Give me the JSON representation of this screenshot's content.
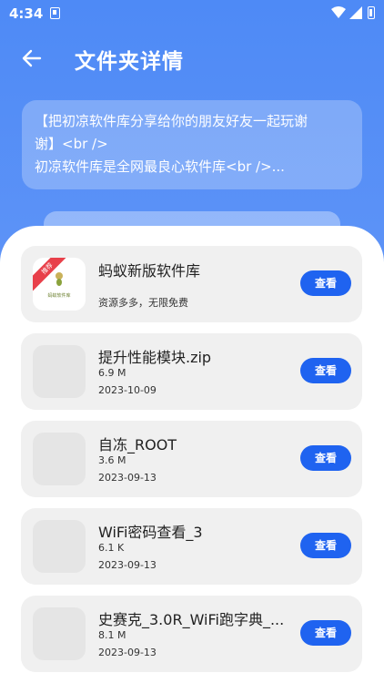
{
  "status_bar": {
    "time": "4:34"
  },
  "header": {
    "title": "文件夹详情"
  },
  "description": {
    "lines": [
      "【把初凉软件库分享给你的朋友好友一起玩谢",
      "谢】<br />",
      "初凉软件库是全网最良心软件库<br />..."
    ]
  },
  "items": [
    {
      "name": "蚂蚁新版软件库",
      "subtitle": "资源多多，无限免费",
      "badge": "推荐",
      "logo_text": "蚂蚁软件库",
      "button": "查看"
    },
    {
      "name": "提升性能模块.zip",
      "size": "6.9 M",
      "date": "2023-10-09",
      "button": "查看"
    },
    {
      "name": "自冻_ROOT",
      "size": "3.6 M",
      "date": "2023-09-13",
      "button": "查看"
    },
    {
      "name": "WiFi密码查看_3",
      "size": "6.1 K",
      "date": "2023-09-13",
      "button": "查看"
    },
    {
      "name": "史赛克_3.0R_WiFi跑字典_...",
      "size": "8.1 M",
      "date": "2023-09-13",
      "button": "查看"
    }
  ],
  "colors": {
    "header_blue": "#4e8af6",
    "button_blue": "#1f63f0",
    "card_gray": "#f0f0f0"
  }
}
